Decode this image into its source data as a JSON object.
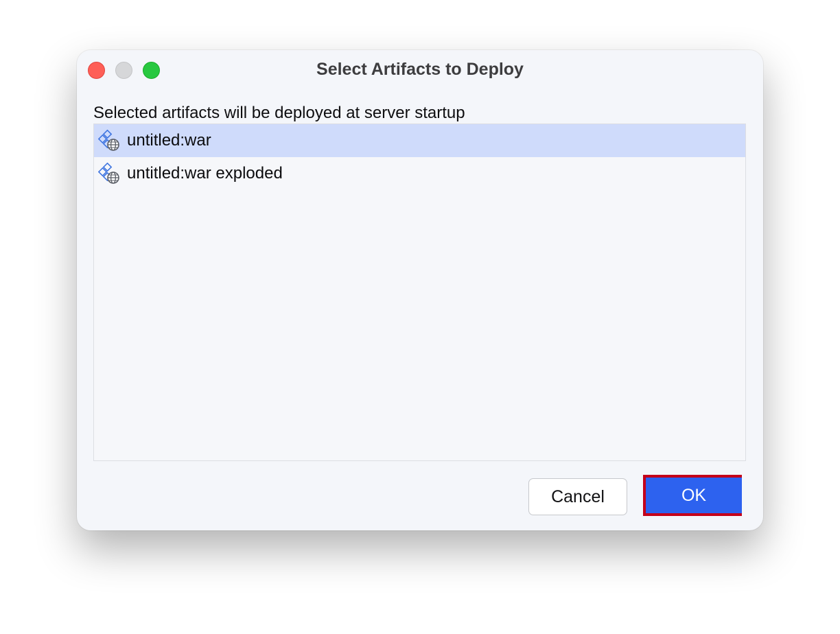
{
  "window": {
    "title": "Select Artifacts to Deploy"
  },
  "caption": "Selected artifacts will be deployed at server startup",
  "artifacts": [
    {
      "label": "untitled:war",
      "icon": "web-artifact-icon",
      "selected": true
    },
    {
      "label": "untitled:war exploded",
      "icon": "web-artifact-icon",
      "selected": false
    }
  ],
  "buttons": {
    "cancel_label": "Cancel",
    "ok_label": "OK"
  },
  "colors": {
    "accent": "#2d62ef",
    "selection": "#cfdbfb",
    "highlight_outline": "#c4001a"
  }
}
